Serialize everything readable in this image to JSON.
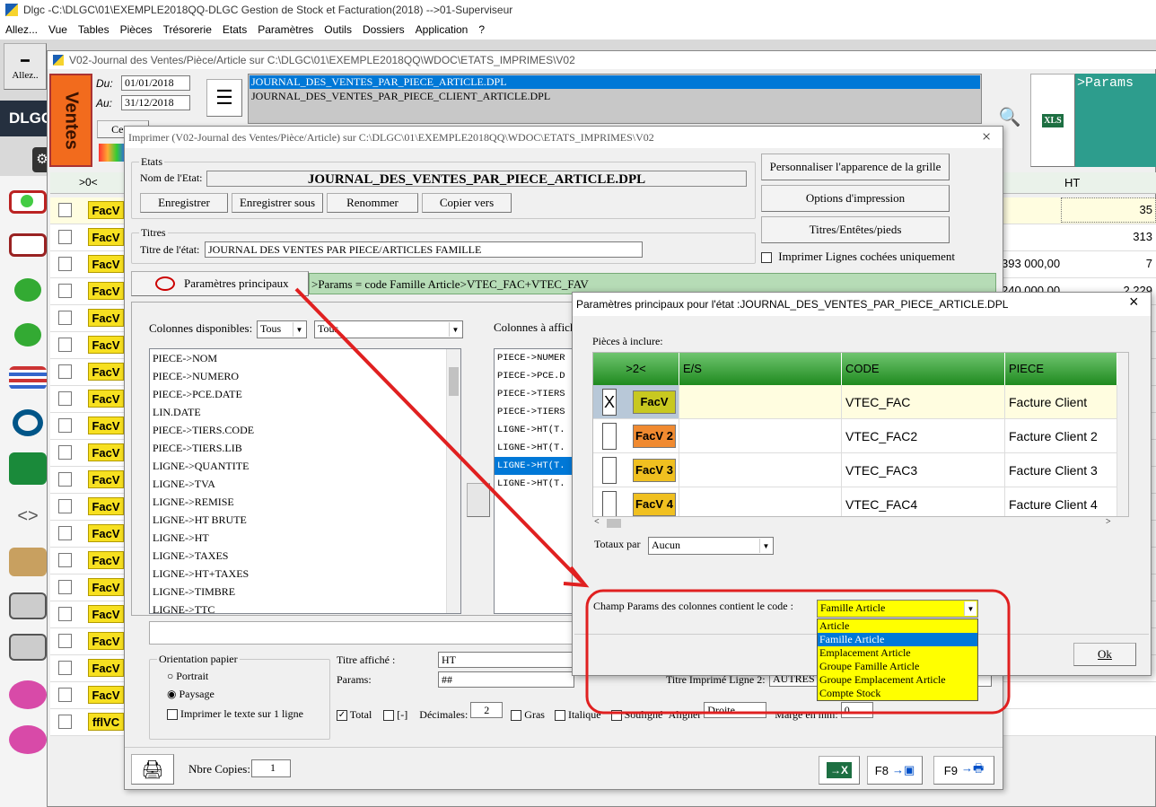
{
  "app": {
    "title": "Dlgc -C:\\DLGC\\01\\EXEMPLE2018QQ-DLGC Gestion de Stock et Facturation(2018) -->01-Superviseur",
    "menu": [
      "Allez...",
      "Vue",
      "Tables",
      "Pièces",
      "Trésorerie",
      "Etats",
      "Paramètres",
      "Outils",
      "Dossiers",
      "Application",
      "?"
    ],
    "allez_button": "Allez..",
    "brand": "DLGC",
    "params_preview": ">Params"
  },
  "journal": {
    "title": "V02-Journal des Ventes/Pièce/Article sur C:\\DLGC\\01\\EXEMPLE2018QQ\\WDOC\\ETATS_IMPRIMES\\V02",
    "ventes_label": "Ventes",
    "du_label": "Du:",
    "du_value": "01/01/2018",
    "au_label": "Au:",
    "au_value": "31/12/2018",
    "ce_jour": "Ce jo",
    "files": [
      "JOURNAL_DES_VENTES_PAR_PIECE_ARTICLE.DPL",
      "JOURNAL_DES_VENTES_PAR_PIECE_CLIENT_ARTICLE.DPL"
    ],
    "grid_header": ">0<",
    "ht_header": "HT",
    "rows": [
      "FacV",
      "FacV",
      "FacV",
      "FacV",
      "FacV",
      "FacV",
      "FacV",
      "FacV",
      "FacV",
      "FacV",
      "FacV",
      "FacV",
      "FacV",
      "FacV",
      "FacV",
      "FacV",
      "FacV",
      "FacV",
      "FacV",
      "fflVC"
    ],
    "right_values": [
      "35",
      "313",
      "393 000,00",
      "7",
      "240 000,00",
      "2 229"
    ]
  },
  "print_dialog": {
    "title": "Imprimer (V02-Journal des Ventes/Pièce/Article)  sur C:\\DLGC\\01\\EXEMPLE2018QQ\\WDOC\\ETATS_IMPRIMES\\V02",
    "close": "×",
    "etats_legend": "Etats",
    "nom_label": "Nom de l'Etat:",
    "nom_value": "JOURNAL_DES_VENTES_PAR_PIECE_ARTICLE.DPL",
    "btn_enregistrer": "Enregistrer",
    "btn_enregistrer_sous": "Enregistrer sous",
    "btn_renommer": "Renommer",
    "btn_copier": "Copier vers",
    "btn_personnaliser": "Personnaliser l'apparence de la grille",
    "btn_options": "Options d'impression",
    "btn_titres": "Titres/Entêtes/pieds",
    "imprimer_cochees": "Imprimer Lignes cochées uniquement",
    "titres_legend": "Titres",
    "titre_label": "Titre de l'état:",
    "titre_value": "JOURNAL DES VENTES  PAR PIECE/ARTICLES FAMILLE",
    "params_button": "Paramètres principaux",
    "params_value": ">Params = code Famille Article>VTEC_FAC+VTEC_FAV",
    "colonnes_dispo": "Colonnes disponibles:",
    "filter1": "Tous",
    "filter2": "Tous",
    "colonnes_affich": "Colonnes à affich",
    "available_columns": [
      "PIECE->NOM",
      "PIECE->NUMERO",
      "PIECE->PCE.DATE",
      "LIN.DATE",
      "PIECE->TIERS.CODE",
      "PIECE->TIERS.LIB",
      "LIGNE->QUANTITE",
      "LIGNE->TVA",
      "LIGNE->REMISE",
      "LIGNE->HT BRUTE",
      "LIGNE->HT",
      "LIGNE->TAXES",
      "LIGNE->HT+TAXES",
      "LIGNE->TIMBRE",
      "LIGNE->TTC"
    ],
    "selected_columns": [
      "PIECE->NUMER",
      "PIECE->PCE.D",
      "PIECE->TIERS",
      "PIECE->TIERS",
      "LIGNE->HT(T.",
      "LIGNE->HT(T.",
      "LIGNE->HT(T.",
      "LIGNE->HT(T."
    ],
    "orientation_legend": "Orientation papier",
    "portrait": "Portrait",
    "paysage": "Paysage",
    "imprimer_1_ligne": "Imprimer le texte sur 1 ligne",
    "titre_affiche_label": "Titre affiché :",
    "titre_affiche_value": "HT",
    "params_label": "Params:",
    "params_field": "##",
    "titre_imprime_label": "Titre Imprimé Ligne 2:",
    "titre_imprime_value": "AUTRES",
    "total": "Total",
    "bracket": "[-]",
    "decimales": "Décimales:",
    "decimales_value": "2",
    "gras": "Gras",
    "italique": "Italique",
    "souligne": "Souligné",
    "aligner": "Aligner",
    "aligner_value": "Droite",
    "marge": "Marge en mm:",
    "marge_value": "0",
    "nbre_copies": "Nbre Copies:",
    "nbre_copies_value": "1",
    "f8": "F8",
    "f9": "F9"
  },
  "params_dialog": {
    "title": "Paramètres principaux pour l'état :JOURNAL_DES_VENTES_PAR_PIECE_ARTICLE.DPL",
    "close": "×",
    "pieces_label": "Pièces à inclure:",
    "columns": [
      ">2<",
      "E/S",
      "CODE",
      "PIECE"
    ],
    "rows": [
      {
        "checked": "X",
        "badge": "FacV",
        "es": "",
        "code": "VTEC_FAC",
        "piece": "Facture Client"
      },
      {
        "checked": "",
        "badge": "FacV 2",
        "es": "",
        "code": "VTEC_FAC2",
        "piece": "Facture Client 2"
      },
      {
        "checked": "",
        "badge": "FacV 3",
        "es": "",
        "code": "VTEC_FAC3",
        "piece": "Facture Client 3"
      },
      {
        "checked": "",
        "badge": "FacV 4",
        "es": "",
        "code": "VTEC_FAC4",
        "piece": "Facture Client 4"
      }
    ],
    "totaux_label": "Totaux par",
    "totaux_value": "Aucun",
    "champ_label": "Champ Params des colonnes contient le code :",
    "champ_value": "Famille Article",
    "champ_options": [
      "Article",
      "Famille Article",
      "Emplacement Article",
      "Groupe Famille Article",
      "Groupe Emplacement Article",
      "Compte Stock"
    ],
    "ok": "Ok"
  },
  "colors": {
    "highlight": "#0078d7",
    "grid_green": "#2e9a2e",
    "annotation_red": "#e02020",
    "fac_yellow": "#f7e020",
    "dropdown_yellow": "#ffff00"
  }
}
